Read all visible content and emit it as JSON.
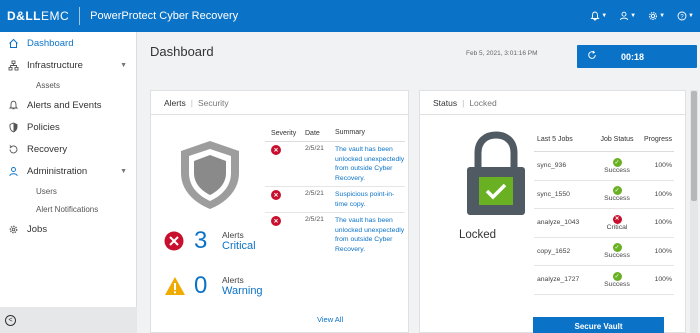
{
  "header": {
    "brand_bold": "D&LL",
    "brand_light": "EMC",
    "app_title": "PowerProtect Cyber Recovery",
    "icons": [
      "bell-icon",
      "user-icon",
      "gear-icon",
      "help-icon"
    ]
  },
  "sidebar": {
    "items": [
      {
        "label": "Dashboard",
        "icon": "home-icon",
        "active": true
      },
      {
        "label": "Infrastructure",
        "icon": "network-icon"
      },
      {
        "label": "Assets",
        "sub": true
      },
      {
        "label": "Alerts and Events",
        "icon": "bell-icon"
      },
      {
        "label": "Policies",
        "icon": "shield-icon"
      },
      {
        "label": "Recovery",
        "icon": "recovery-icon"
      },
      {
        "label": "Administration",
        "icon": "user-icon"
      },
      {
        "label": "Users",
        "sub": true
      },
      {
        "label": "Alert Notifications",
        "sub": true
      },
      {
        "label": "Jobs",
        "icon": "jobs-icon"
      }
    ]
  },
  "page": {
    "title": "Dashboard",
    "timestamp": "Feb 5, 2021, 3:01:16 PM",
    "timer": "00:18"
  },
  "alerts": {
    "title": "Alerts",
    "subtitle": "Security",
    "critical": {
      "count": "3",
      "label": "Alerts",
      "level": "Critical"
    },
    "warning": {
      "count": "0",
      "label": "Alerts",
      "level": "Warning"
    },
    "columns": [
      "Severity",
      "Date",
      "Summary"
    ],
    "rows": [
      {
        "date": "2/5/21",
        "summary": "The vault has been unlocked unexpectedly from outside Cyber Recovery."
      },
      {
        "date": "2/5/21",
        "summary": "Suspicious point-in-time copy."
      },
      {
        "date": "2/5/21",
        "summary": "The vault has been unlocked unexpectedly from outside Cyber Recovery."
      }
    ],
    "view_all": "View All"
  },
  "status": {
    "title": "Status",
    "state": "Locked",
    "lock_label": "Locked",
    "columns": [
      "Last 5 Jobs",
      "Job Status",
      "Progress"
    ],
    "jobs": [
      {
        "name": "sync_936",
        "status": "Success",
        "ok": true,
        "progress": "100%"
      },
      {
        "name": "sync_1550",
        "status": "Success",
        "ok": true,
        "progress": "100%"
      },
      {
        "name": "analyze_1043",
        "status": "Critical",
        "ok": false,
        "progress": "100%"
      },
      {
        "name": "copy_1652",
        "status": "Success",
        "ok": true,
        "progress": "100%"
      },
      {
        "name": "analyze_1727",
        "status": "Success",
        "ok": true,
        "progress": "100%"
      }
    ],
    "secure_button": "Secure Vault"
  },
  "colors": {
    "accent": "#0b73c7",
    "critical": "#c8102e",
    "success": "#6ab023",
    "warning": "#f0ab00"
  }
}
